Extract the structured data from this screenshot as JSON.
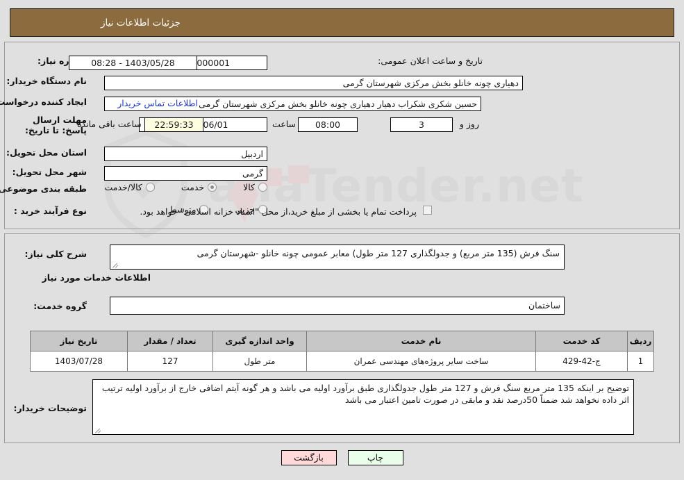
{
  "header": {
    "title": "جزئیات اطلاعات نیاز"
  },
  "colors": {
    "header_bg": "#8c6b3f",
    "page_bg": "#e0e0e0",
    "link": "#1a34d8",
    "countdown_bg": "#feffe0",
    "table_header_bg": "#c7c7c7",
    "print_button_bg": "#e9ffe9",
    "back_button_bg": "#ffd9d9"
  },
  "form": {
    "need_number_label": "شماره نیاز:",
    "need_number_value": "1103094704000001",
    "announce_datetime_label": "تاریخ و ساعت اعلان عمومی:",
    "announce_datetime_value": "1403/05/28 - 08:28",
    "buyer_org_label": "نام دستگاه خریدار:",
    "buyer_org_value": "دهیاری چونه خانلو بخش مرکزی شهرستان گرمی",
    "requester_label": "ایجاد کننده درخواست:",
    "requester_value": "حسین شکری شکراب دهیار دهیاری چونه خانلو بخش مرکزی شهرستان گرمی",
    "contact_link": "اطلاعات تماس خریدار",
    "deadline_label": "مهلت ارسال پاسخ: تا تاریخ:",
    "deadline_date": "1403/06/01",
    "deadline_hour_label": "ساعت",
    "deadline_hour": "08:00",
    "remaining_days": "3",
    "remaining_days_label": "روز و",
    "remaining_time": "22:59:33",
    "remaining_time_label": "ساعت باقی مانده",
    "province_label": "استان محل تحویل:",
    "province_value": "اردبیل",
    "city_label": "شهر محل تحویل:",
    "city_value": "گرمی",
    "category_label": "طبقه بندی موضوعی:",
    "category_options": [
      {
        "label": "کالا",
        "selected": false
      },
      {
        "label": "خدمت",
        "selected": true
      },
      {
        "label": "کالا/خدمت",
        "selected": false
      }
    ],
    "process_label": "نوع فرآیند خرید :",
    "process_options": [
      {
        "label": "جزیی",
        "selected": false
      },
      {
        "label": "متوسط",
        "selected": false
      }
    ],
    "treasury_checkbox_checked": false,
    "treasury_text": "پرداخت تمام یا بخشی از مبلغ خرید،از محل \"اسناد خزانه اسلامی\" خواهد بود."
  },
  "description": {
    "label": "شرح کلی نیاز:",
    "value": "سنگ فرش (135 متر مربع) و جدولگذاری 127 متر طول) معابر عمومی چونه خانلو -شهرستان گرمی"
  },
  "services_section": {
    "title": "اطلاعات خدمات مورد نیاز",
    "group_label": "گروه خدمت:",
    "group_value": "ساختمان"
  },
  "table": {
    "columns": [
      "ردیف",
      "کد خدمت",
      "نام خدمت",
      "واحد اندازه گیری",
      "تعداد / مقدار",
      "تاریخ نیاز"
    ],
    "rows": [
      {
        "row_no": "1",
        "service_code": "ج-42-429",
        "service_name": "ساخت سایر پروژه‌های مهندسی عمران",
        "unit": "متر طول",
        "quantity": "127",
        "need_date": "1403/07/28"
      }
    ]
  },
  "buyer_notes": {
    "label": "توضیحات خریدار:",
    "value": "توضیح بر اینکه 135 متر مربع سنگ فرش و 127 متر طول جدولگذاری طبق برآورد اولیه می باشد و هر گونه آیتم اضافی خارج از برآورد اولیه ترتیب اثر داده نخواهد شد ضمناً 50درصد نقد و مابقی در صورت تامین اعتبار می باشد"
  },
  "buttons": {
    "print": "چاپ",
    "back": "بازگشت"
  }
}
